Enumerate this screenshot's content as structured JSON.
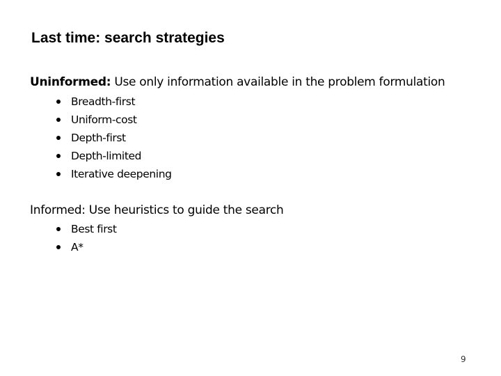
{
  "slide": {
    "title": "Last time: search strategies",
    "sections": [
      {
        "term": "Uninformed:",
        "description": " Use only information available in the problem formulation",
        "term_bold": true,
        "items": [
          "Breadth-first",
          "Uniform-cost",
          "Depth-first",
          "Depth-limited",
          "Iterative deepening"
        ]
      },
      {
        "term": "Informed:",
        "description": " Use heuristics to guide the search",
        "term_bold": false,
        "items": [
          "Best first",
          "A*"
        ]
      }
    ],
    "page_number": "9"
  }
}
